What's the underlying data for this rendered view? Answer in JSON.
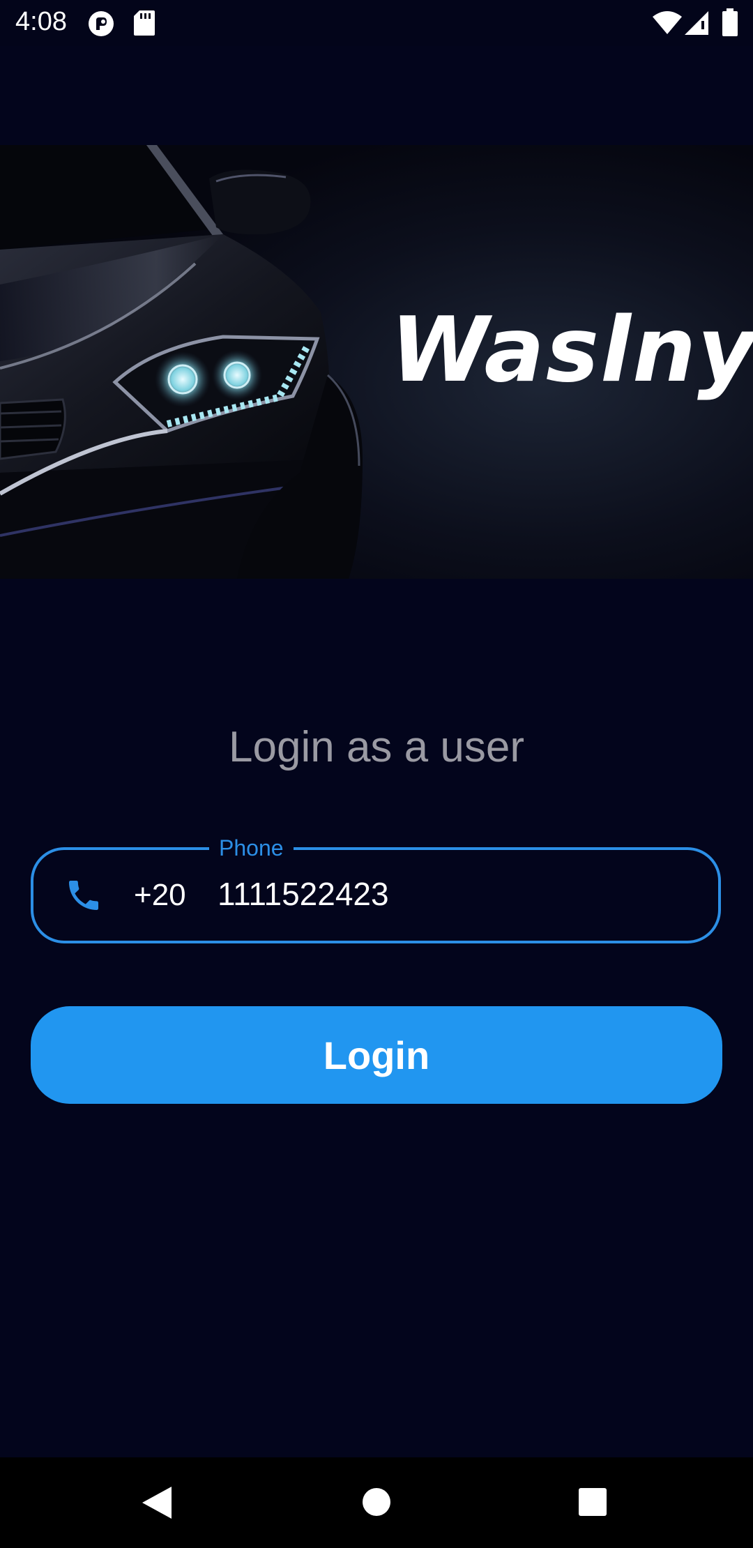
{
  "status_bar": {
    "time": "4:08",
    "icons": [
      "pocket-cast-icon",
      "sd-card-icon",
      "wifi-icon",
      "signal-icon",
      "battery-icon"
    ]
  },
  "hero": {
    "brand_name": "Waslny",
    "image": "car-headlight-image"
  },
  "login": {
    "title": "Login as a user",
    "phone_field": {
      "label": "Phone",
      "country_code": "+20",
      "value": "1111522423",
      "icon": "phone-icon"
    },
    "button_label": "Login"
  },
  "nav_bar": {
    "icons": [
      "back-icon",
      "home-icon",
      "recents-icon"
    ]
  },
  "colors": {
    "background": "#03051c",
    "accent": "#2196f0",
    "title_text": "#9a9aa3"
  }
}
